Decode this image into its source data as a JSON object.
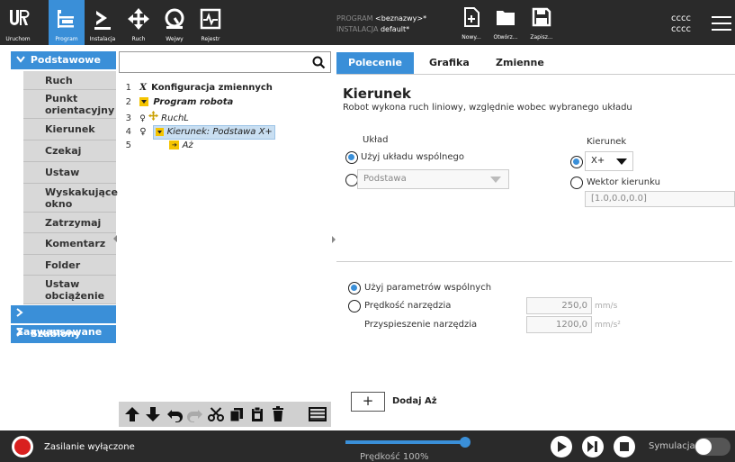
{
  "topbar": {
    "nav": [
      {
        "label": "Uruchom",
        "icon": "run-icon"
      },
      {
        "label": "Program",
        "icon": "program-icon"
      },
      {
        "label": "Instalacja",
        "icon": "installation-icon"
      },
      {
        "label": "Ruch",
        "icon": "move-icon"
      },
      {
        "label": "Wejwy",
        "icon": "io-icon"
      },
      {
        "label": "Rejestr",
        "icon": "log-icon"
      }
    ],
    "program_label": "PROGRAM",
    "program_name": "<beznazwy>*",
    "installation_label": "INSTALACJA",
    "installation_name": "default*",
    "file_buttons": [
      {
        "label": "Nowy...",
        "icon": "new-file-icon"
      },
      {
        "label": "Otwórz...",
        "icon": "open-folder-icon"
      },
      {
        "label": "Zapisz...",
        "icon": "save-icon"
      }
    ],
    "user_line1": "cccc",
    "user_line2": "cccc"
  },
  "left_menu": {
    "basic": "Podstawowe",
    "commands": [
      "Ruch",
      "Punkt orientacyjny",
      "Kierunek",
      "Czekaj",
      "Ustaw",
      "Wyskakujące okno",
      "Zatrzymaj",
      "Komentarz",
      "Folder",
      "Ustaw obciążenie"
    ],
    "advanced": "Zaawansowane",
    "templates": "Szablony"
  },
  "tree": {
    "lines": [
      {
        "num": "1",
        "text": "Konfiguracja zmiennych"
      },
      {
        "num": "2",
        "text": "Program robota"
      },
      {
        "num": "3",
        "text": "RuchL"
      },
      {
        "num": "4",
        "text": "Kierunek: Podstawa X+"
      },
      {
        "num": "5",
        "text": "Aż"
      }
    ]
  },
  "tabs": [
    "Polecenie",
    "Grafika",
    "Zmienne"
  ],
  "content": {
    "title": "Kierunek",
    "description": "Robot wykona ruch liniowy, względnie wobec wybranego układu",
    "frame_label": "Układ",
    "use_shared_frame": "Użyj układu wspólnego",
    "frame_select": "Podstawa",
    "direction_label": "Kierunek",
    "direction_value": "X+",
    "direction_vector_label": "Wektor kierunku",
    "direction_vector_value": "[1.0,0.0,0.0]",
    "use_shared_params": "Użyj parametrów wspólnych",
    "tool_speed_label": "Prędkość narzędzia",
    "tool_speed_value": "250,0",
    "tool_speed_unit": "mm/s",
    "tool_accel_label": "Przyspieszenie narzędzia",
    "tool_accel_value": "1200,0",
    "tool_accel_unit": "mm/s²",
    "add_until_label": "Dodaj Aż"
  },
  "bottombar": {
    "power_status": "Zasilanie wyłączone",
    "speed_label": "Prędkość 100%",
    "speed_fraction": 1.0,
    "simulation_label": "Symulacja"
  },
  "colors": {
    "accent": "#3a8fd8",
    "topbar_bg": "#2a2a2a",
    "power_red": "#d9201f",
    "selection": "#c9dff2"
  }
}
